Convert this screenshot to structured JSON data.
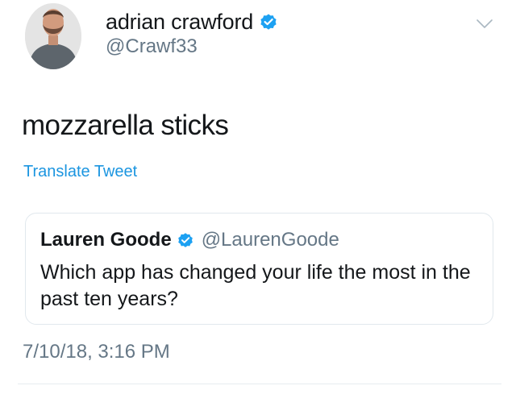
{
  "author": {
    "display_name": "adrian crawford",
    "handle": "@Crawf33",
    "avatar_icon": "avatar-photo",
    "verified_icon": "verified-badge-icon"
  },
  "tweet": {
    "text": "mozzarella sticks",
    "translate_label": "Translate Tweet",
    "timestamp": "7/10/18, 3:16 PM",
    "menu_icon": "chevron-down-icon"
  },
  "quoted_tweet": {
    "display_name": "Lauren Goode",
    "handle": "@LaurenGoode",
    "text": "Which app has changed your life the most in the past ten years?",
    "verified_icon": "verified-badge-icon"
  },
  "colors": {
    "text": "#14171a",
    "secondary_text": "#657786",
    "link": "#1b95e0",
    "verified": "#1da1f2",
    "border": "#e1e8ed"
  }
}
